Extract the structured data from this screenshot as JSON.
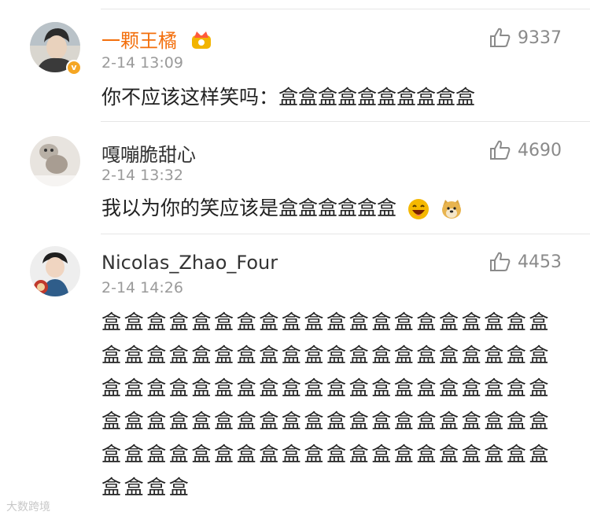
{
  "comments": [
    {
      "username": "一颗王橘",
      "time": "2-14 13:09",
      "likes": "9337",
      "text": "你不应该这样笑吗：盒盒盒盒盒盒盒盒盒盒",
      "verified_badge": "v",
      "name_color": "#f36f0c"
    },
    {
      "username": "嘎嘣脆甜心",
      "time": "2-14 13:32",
      "likes": "4690",
      "text": "我以为你的笑应该是盒盒盒盒盒盒",
      "emojis": [
        "laughing-face-emoji",
        "doge-emoji"
      ]
    },
    {
      "username": "Nicolas_Zhao_Four",
      "time": "2-14 14:26",
      "likes": "4453",
      "text": "盒盒盒盒盒盒盒盒盒盒盒盒盒盒盒盒盒盒盒盒盒盒盒盒盒盒盒盒盒盒盒盒盒盒盒盒盒盒盒盒盒盒盒盒盒盒盒盒盒盒盒盒盒盒盒盒盒盒盒盒盒盒盒盒盒盒盒盒盒盒盒盒盒盒盒盒盒盒盒盒盒盒盒盒盒盒盒盒盒盒盒盒盒盒盒盒盒盒盒盒盒盒盒盒"
    }
  ],
  "watermark": "大数跨境",
  "colors": {
    "vip_name": "#f36f0c",
    "meta": "#9a9a9a",
    "text": "#222222"
  }
}
